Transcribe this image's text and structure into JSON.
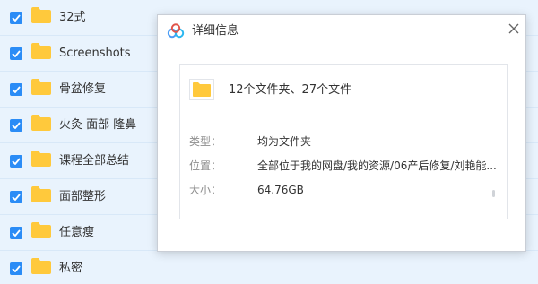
{
  "file_list": {
    "items": [
      {
        "name": "32式",
        "checked": true
      },
      {
        "name": "Screenshots",
        "checked": true
      },
      {
        "name": "骨盆修复",
        "checked": true
      },
      {
        "name": "火灸 面部 隆鼻",
        "checked": true
      },
      {
        "name": "课程全部总结",
        "checked": true
      },
      {
        "name": "面部整形",
        "checked": true
      },
      {
        "name": "任意瘦",
        "checked": true
      },
      {
        "name": "私密",
        "checked": true
      }
    ]
  },
  "dialog": {
    "title": "详细信息",
    "summary": "12个文件夹、27个文件",
    "rows": [
      {
        "label": "类型：",
        "value": "均为文件夹"
      },
      {
        "label": "位置：",
        "value": "全部位于我的网盘/我的资源/06产后修复/刘艳能..."
      },
      {
        "label": "大小：",
        "value": "64.76GB"
      }
    ]
  },
  "colors": {
    "row_bg": "#e9f3fd",
    "checkbox": "#2b8cf6",
    "folder": "#ffc93c",
    "label_text": "#8e8e8e"
  },
  "icons": {
    "checkbox": "checkmark-icon",
    "folder": "folder-icon",
    "logo": "baidu-netdisk-logo-icon",
    "close": "close-icon"
  }
}
